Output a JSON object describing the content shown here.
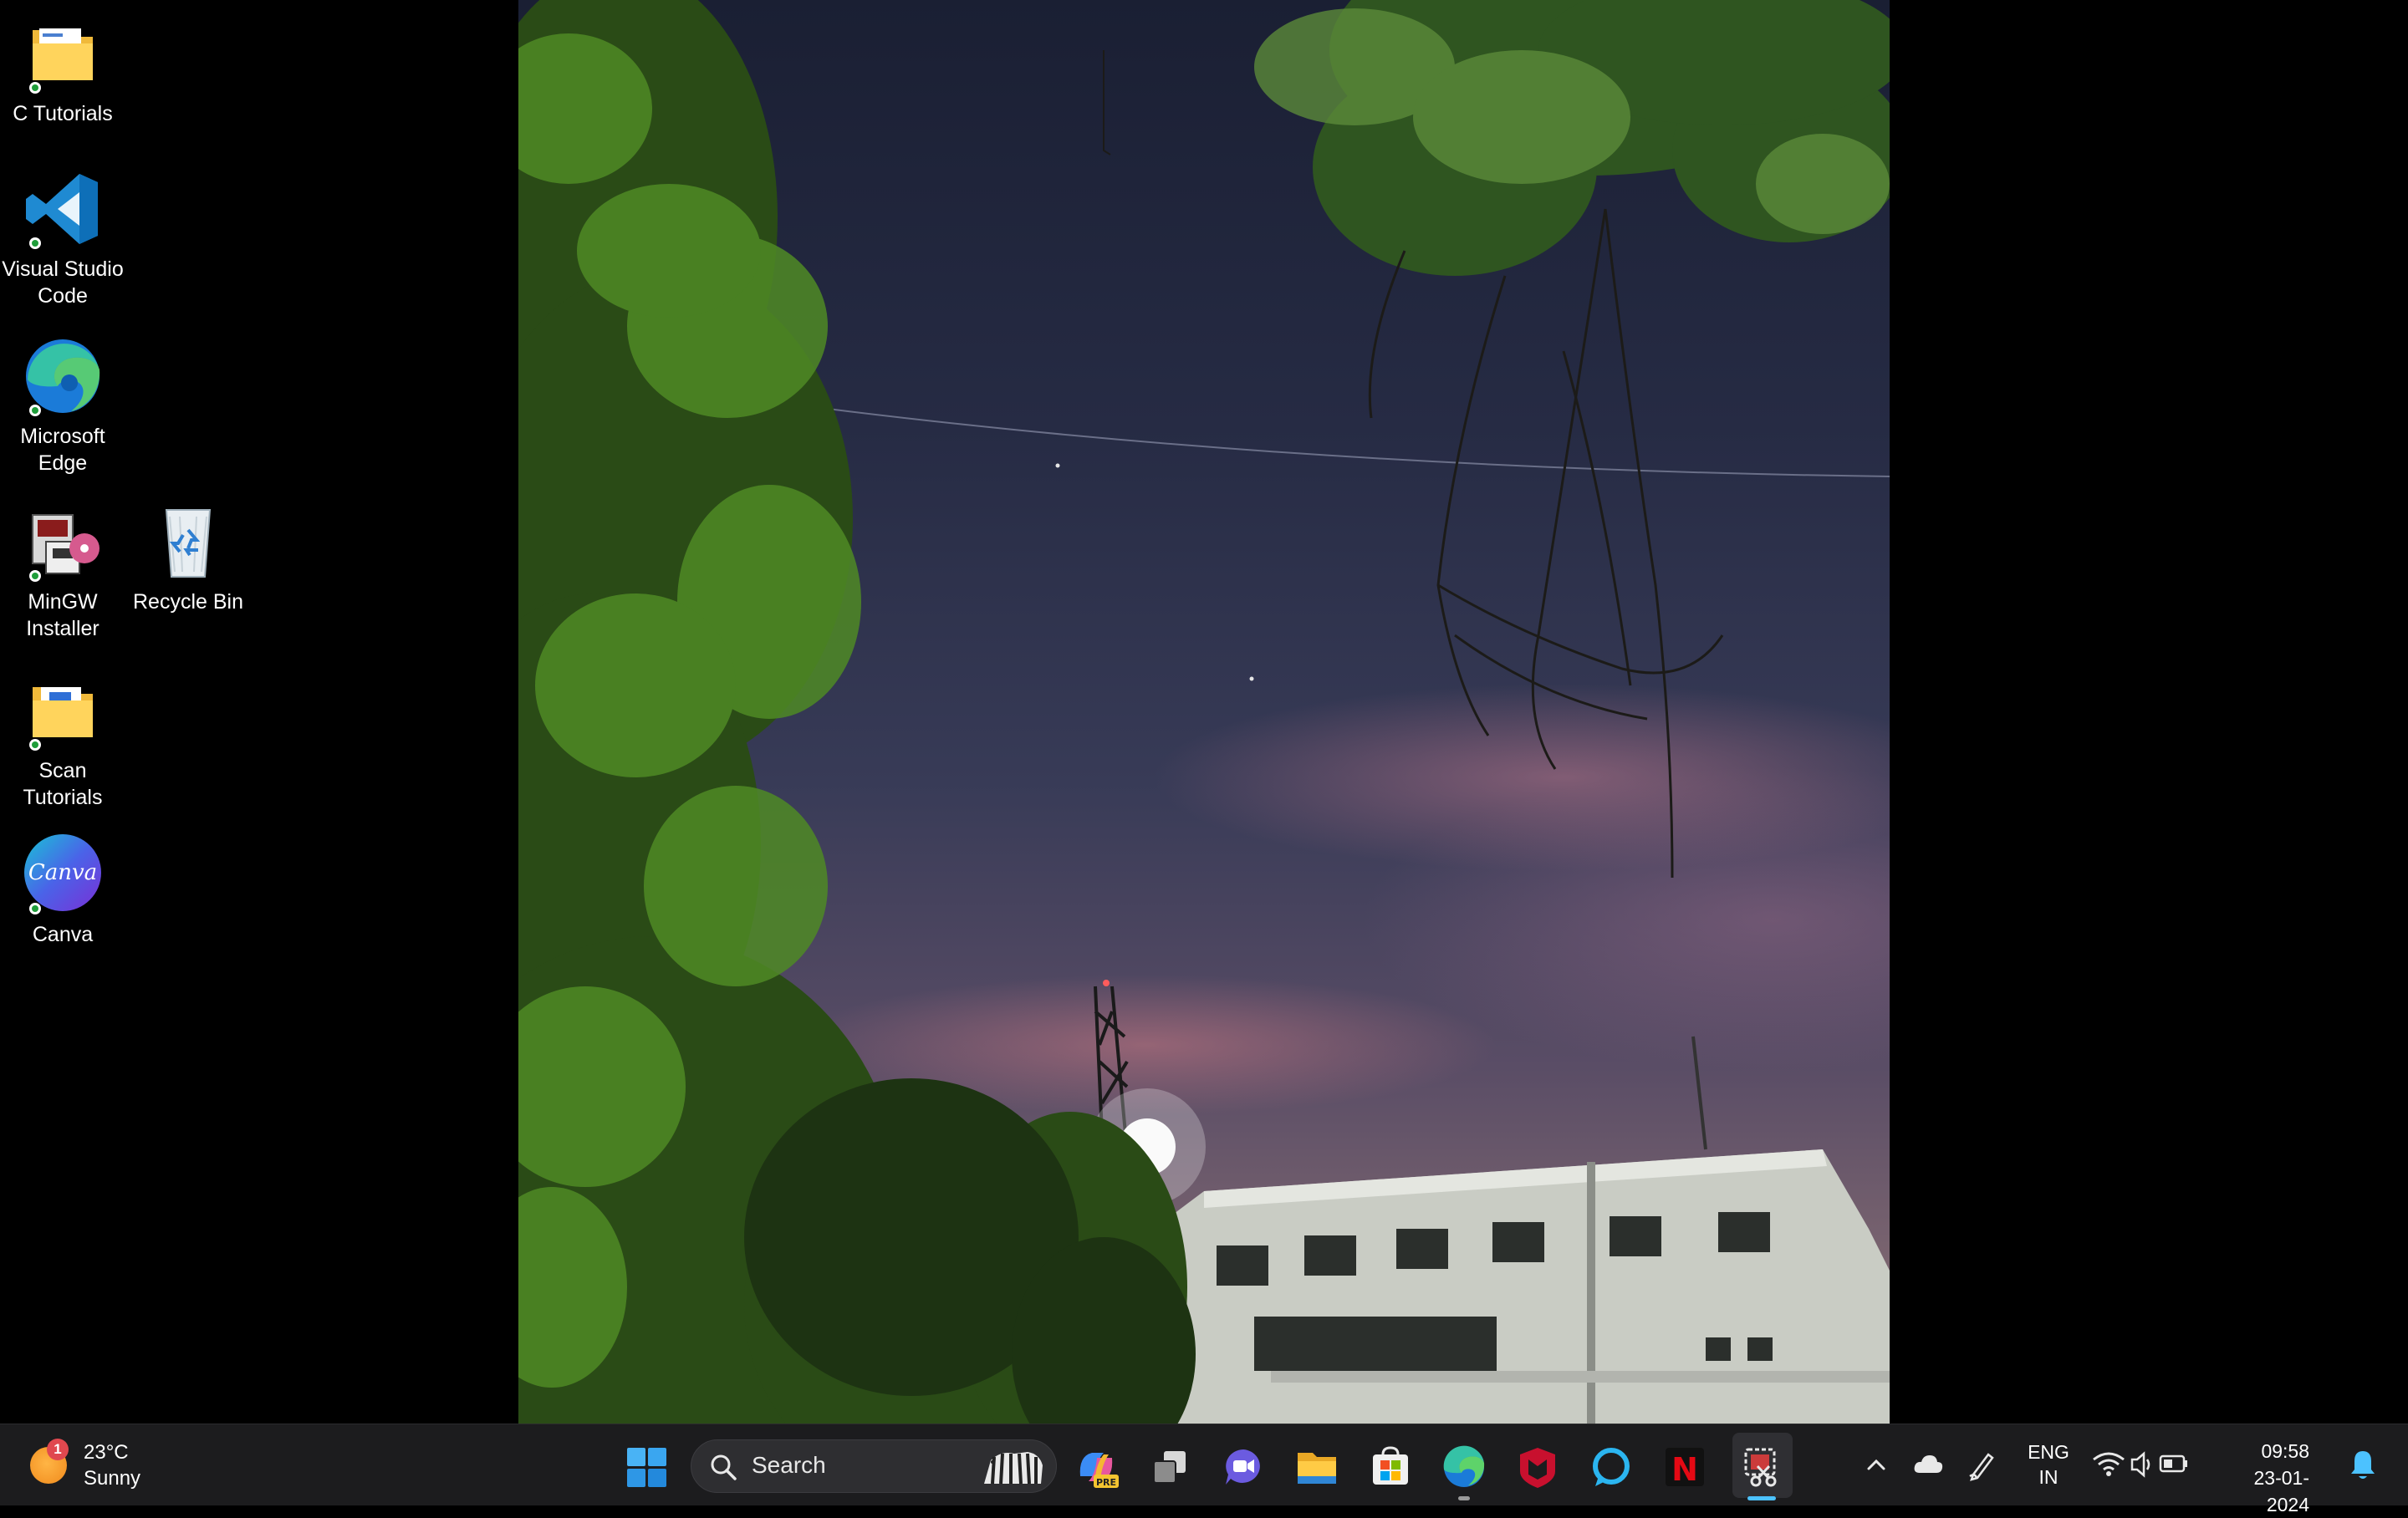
{
  "desktop": {
    "icons": [
      {
        "label": "C Tutorials",
        "icon": "folder-icon"
      },
      {
        "label": "Visual Studio\nCode",
        "icon": "vscode-icon"
      },
      {
        "label": "Microsoft\nEdge",
        "icon": "edge-icon"
      },
      {
        "label": "MinGW\nInstaller",
        "icon": "mingw-installer-icon"
      },
      {
        "label": "Recycle Bin",
        "icon": "recycle-bin-icon"
      },
      {
        "label": "Scan\nTutorials",
        "icon": "folder-icon"
      },
      {
        "label": "Canva",
        "icon": "canva-icon",
        "logo_text": "Canva"
      }
    ]
  },
  "taskbar": {
    "weather": {
      "temperature": "23°C",
      "condition": "Sunny",
      "badge": "1"
    },
    "search": {
      "placeholder": "Search"
    },
    "apps": [
      {
        "name": "copilot",
        "icon": "copilot-icon"
      },
      {
        "name": "task-view",
        "icon": "task-view-icon"
      },
      {
        "name": "teams-chat",
        "icon": "chat-icon"
      },
      {
        "name": "file-explorer",
        "icon": "folder-icon"
      },
      {
        "name": "microsoft-store",
        "icon": "store-icon"
      },
      {
        "name": "edge",
        "icon": "edge-icon"
      },
      {
        "name": "mcafee",
        "icon": "mcafee-icon"
      },
      {
        "name": "alexa",
        "icon": "alexa-icon"
      },
      {
        "name": "netflix",
        "icon": "netflix-icon",
        "logo_text": "N"
      },
      {
        "name": "snipping-tool",
        "icon": "snipping-tool-icon"
      }
    ],
    "tray": {
      "language": "ENG",
      "region": "IN",
      "time": "09:58",
      "date": "23-01-2024"
    },
    "colors": {
      "background": "#1c1c1e",
      "accent": "#4cc2ff"
    }
  }
}
